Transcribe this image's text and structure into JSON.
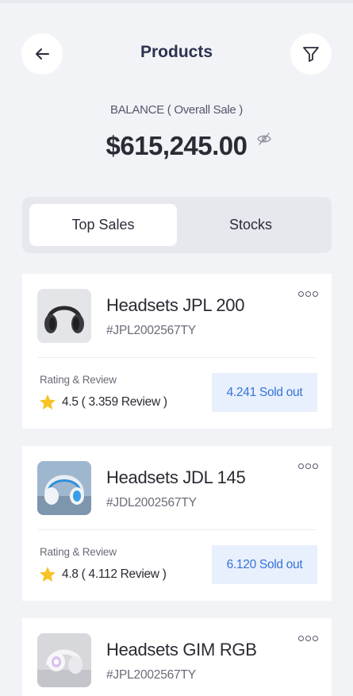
{
  "header": {
    "title": "Products",
    "back_icon": "arrow-left-icon",
    "filter_icon": "filter-icon"
  },
  "balance": {
    "label": "BALANCE ( Overall Sale )",
    "amount": "$615,245.00",
    "visibility_icon": "eye-off-icon"
  },
  "tabs": [
    {
      "label": "Top Sales",
      "active": true
    },
    {
      "label": "Stocks",
      "active": false
    }
  ],
  "products": [
    {
      "name": "Headsets JPL 200",
      "code": "#JPL2002567TY",
      "rating_label": "Rating & Review",
      "rating": "4.5 ( 3.359 Review )",
      "sold": "4.241 Sold out"
    },
    {
      "name": "Headsets JDL 145",
      "code": "#JDL2002567TY",
      "rating_label": "Rating & Review",
      "rating": "4.8 ( 4.112 Review )",
      "sold": "6.120 Sold out"
    },
    {
      "name": "Headsets GIM RGB",
      "code": "#JPL2002567TY"
    }
  ],
  "colors": {
    "background": "#f2f3f6",
    "accent_blue": "#3573d6",
    "sold_bg": "#e8f0fd",
    "star": "#f7c325"
  }
}
